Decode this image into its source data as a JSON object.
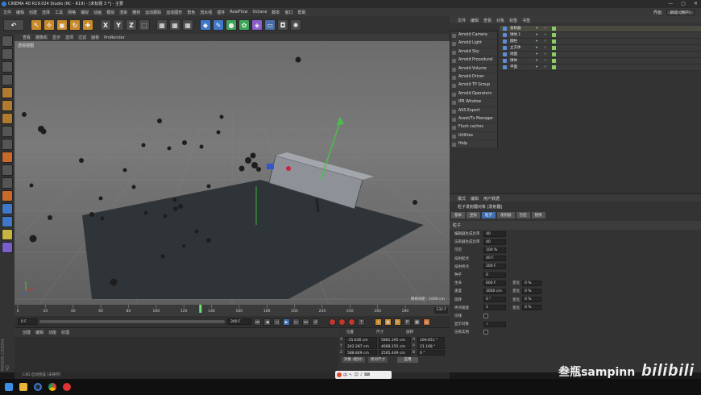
{
  "window": {
    "title": "CINEMA 4D R19.024 Studio (RC - R19) - [未标题 3 *] - 主要",
    "controls": [
      "—",
      "▢",
      "✕"
    ]
  },
  "menu": {
    "items": [
      "文件",
      "编辑",
      "创建",
      "选择",
      "工具",
      "网格",
      "捕捉",
      "动画",
      "模拟",
      "渲染",
      "雕刻",
      "运动跟踪",
      "运动图形",
      "角色",
      "流水线",
      "插件",
      "RealFlow",
      "Octane",
      "脚本",
      "窗口",
      "帮助"
    ],
    "layout_label": "界面:",
    "layout_value": "启动 (用户)"
  },
  "viewport": {
    "menu": [
      "查看",
      "摄像机",
      "显示",
      "选项",
      "过滤",
      "面板",
      "ProRender"
    ],
    "label": "透视视图",
    "grid_info": "网格间距 : 1000 cm"
  },
  "timeline": {
    "ticks": [
      "0",
      "20",
      "40",
      "60",
      "80",
      "100",
      "120",
      "140",
      "160",
      "180",
      "200",
      "220",
      "240",
      "260",
      "280"
    ],
    "current_frame": "132 F",
    "playhead_frame": 132
  },
  "playbar": {
    "start": "0 F",
    "end": "300 F",
    "min_field": "0 F"
  },
  "bottom_left": {
    "menu": [
      "创建",
      "编辑",
      "功能",
      "纹理"
    ]
  },
  "coords": {
    "headers": [
      "位置",
      "尺寸",
      "旋转"
    ],
    "rows": [
      {
        "axis": "X",
        "pos": "-15.636 cm",
        "size": "5881.195 cm",
        "rot_axis": "H",
        "rot": "169.651 °"
      },
      {
        "axis": "Y",
        "pos": "242.287 cm",
        "size": "4668.155 cm",
        "rot_axis": "P",
        "rot": "21.108 °"
      },
      {
        "axis": "Z",
        "pos": "588.849 cm",
        "size": "2565.449 cm",
        "rot_axis": "B",
        "rot": "0 °"
      }
    ],
    "mode": "对象 (相对)",
    "size_mode": "绝对尺寸",
    "apply": "应用"
  },
  "status": {
    "text": "C4D 启动完成 [未保存]"
  },
  "plugin_menu": {
    "items": [
      "Arnold Camera",
      "Arnold Light",
      "Arnold Sky",
      "Arnold Procedural",
      "Arnold Volume",
      "Arnold Driver",
      "Arnold TP Group",
      "Arnold Operators",
      "IPR Window",
      "ASS Export",
      "Asset/Tx Manager",
      "Flush caches",
      "Utilities",
      "Help"
    ]
  },
  "object_manager": {
    "menu": [
      "文件",
      "编辑",
      "查看",
      "对象",
      "标签",
      "书签"
    ],
    "objects": [
      {
        "name": "发射器",
        "selected": true
      },
      {
        "name": "球体.1",
        "selected": false
      },
      {
        "name": "圆柱",
        "selected": false
      },
      {
        "name": "立方体",
        "selected": false
      },
      {
        "name": "地面",
        "selected": false
      },
      {
        "name": "球体",
        "selected": false
      },
      {
        "name": "平面",
        "selected": false
      }
    ]
  },
  "attributes": {
    "menu": [
      "模式",
      "编辑",
      "用户数据"
    ],
    "title": "粒子发射器对象 [发射器]",
    "tabs": [
      "基本",
      "坐标",
      "粒子",
      "发射器",
      "包括",
      "替换"
    ],
    "active_tab": "粒子",
    "section": "粒子",
    "rows": [
      {
        "label": "编辑器生成比率",
        "value": "40",
        "label2": "",
        "value2": ""
      },
      {
        "label": "渲染器生成比率",
        "value": "40",
        "label2": "",
        "value2": ""
      },
      {
        "label": "可见",
        "value": "100 %",
        "label2": "",
        "value2": ""
      },
      {
        "label": "投射起点",
        "value": "40 F",
        "label2": "",
        "value2": ""
      },
      {
        "label": "投射终点",
        "value": "200 F",
        "label2": "",
        "value2": ""
      },
      {
        "label": "种子",
        "value": "0",
        "label2": "",
        "value2": ""
      },
      {
        "label": "生命",
        "value": "600 F",
        "label2": "变化",
        "value2": "0 %"
      },
      {
        "label": "速度",
        "value": "3000 cm",
        "label2": "变化",
        "value2": "0 %"
      },
      {
        "label": "旋转",
        "value": "0 °",
        "label2": "变化",
        "value2": "0 %"
      },
      {
        "label": "终点缩放",
        "value": "1",
        "label2": "变化",
        "value2": "0 %"
      },
      {
        "label": "切线",
        "value": "",
        "label2": "",
        "value2": ""
      },
      {
        "label": "显示对象",
        "value": "✓",
        "label2": "",
        "value2": ""
      },
      {
        "label": "渲染实例",
        "value": "",
        "label2": "",
        "value2": ""
      }
    ]
  },
  "watermark": {
    "text": "叁瓶sampinn",
    "logo": "bilibili"
  },
  "maxon_label": "MAXON CINEMA 4D"
}
